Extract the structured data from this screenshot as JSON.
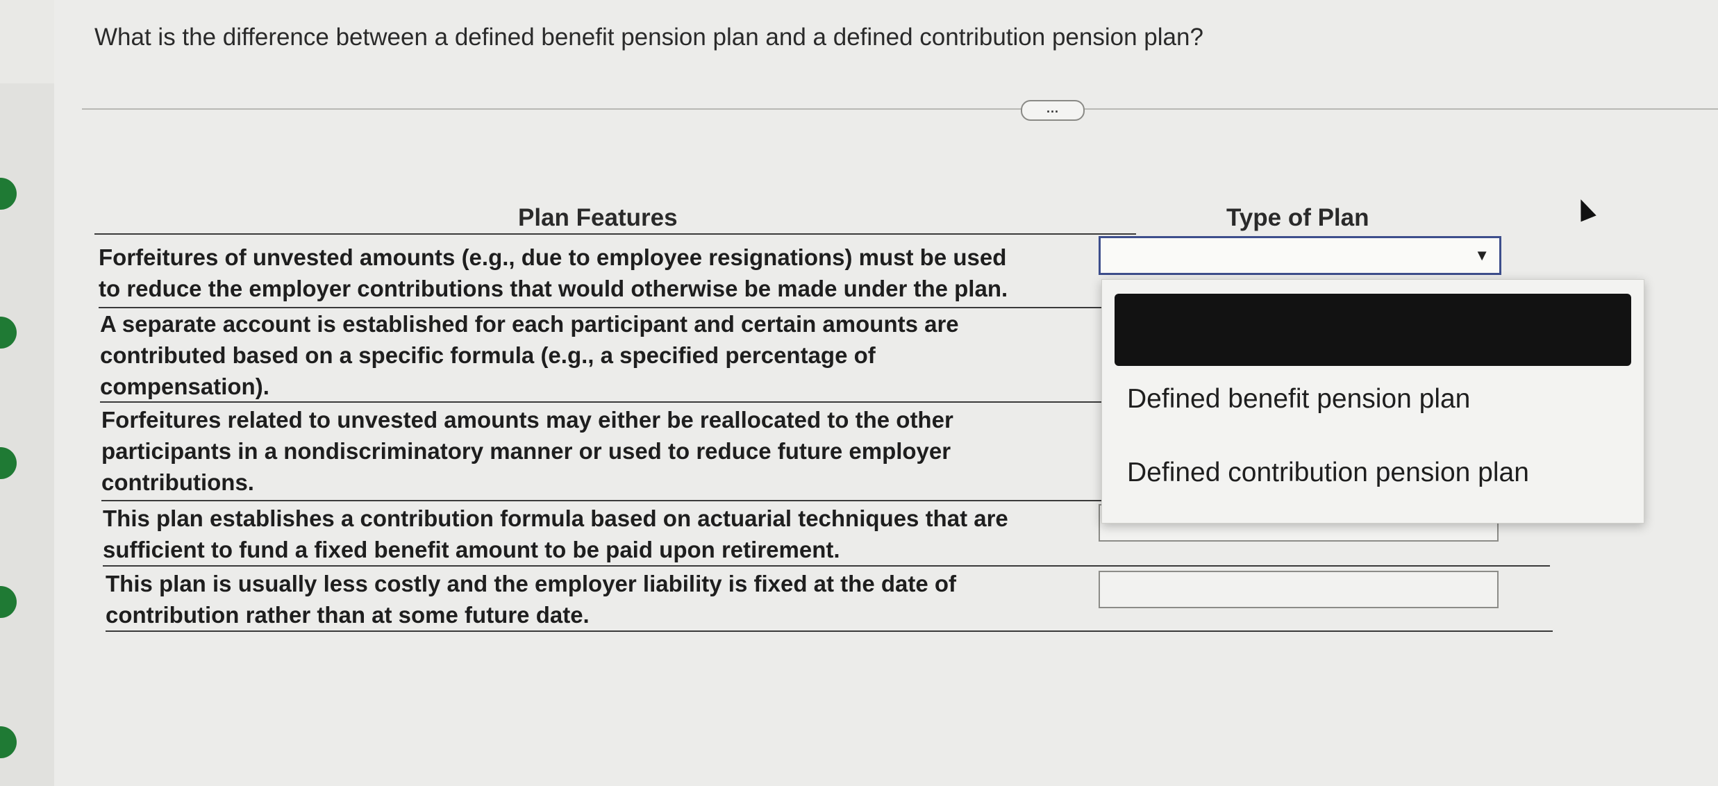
{
  "question": "What is the difference between a defined benefit pension plan and a defined contribution pension plan?",
  "expand_button": "...",
  "table": {
    "headers": {
      "features": "Plan Features",
      "type": "Type of Plan"
    },
    "rows": [
      {
        "feature": "Forfeitures of unvested amounts (e.g., due to employee resignations) must be used\nto reduce the employer contributions that would otherwise be made under the plan."
      },
      {
        "feature": "A separate account is established for each participant and certain amounts are\ncontributed based on a specific formula (e.g., a specified percentage of\ncompensation)."
      },
      {
        "feature": "Forfeitures related to unvested amounts may either be reallocated to the other\nparticipants in a nondiscriminatory manner or used to reduce future employer\ncontributions."
      },
      {
        "feature": "This plan establishes a contribution formula based on actuarial techniques that are\nsufficient to fund a fixed benefit amount to be paid upon retirement."
      },
      {
        "feature": "This plan is usually less costly and the employer liability is fixed at the date of\ncontribution rather than at some future date."
      }
    ]
  },
  "dropdown": {
    "arrow": "▼",
    "options": [
      "",
      "Defined benefit pension plan",
      "Defined contribution pension plan"
    ]
  }
}
